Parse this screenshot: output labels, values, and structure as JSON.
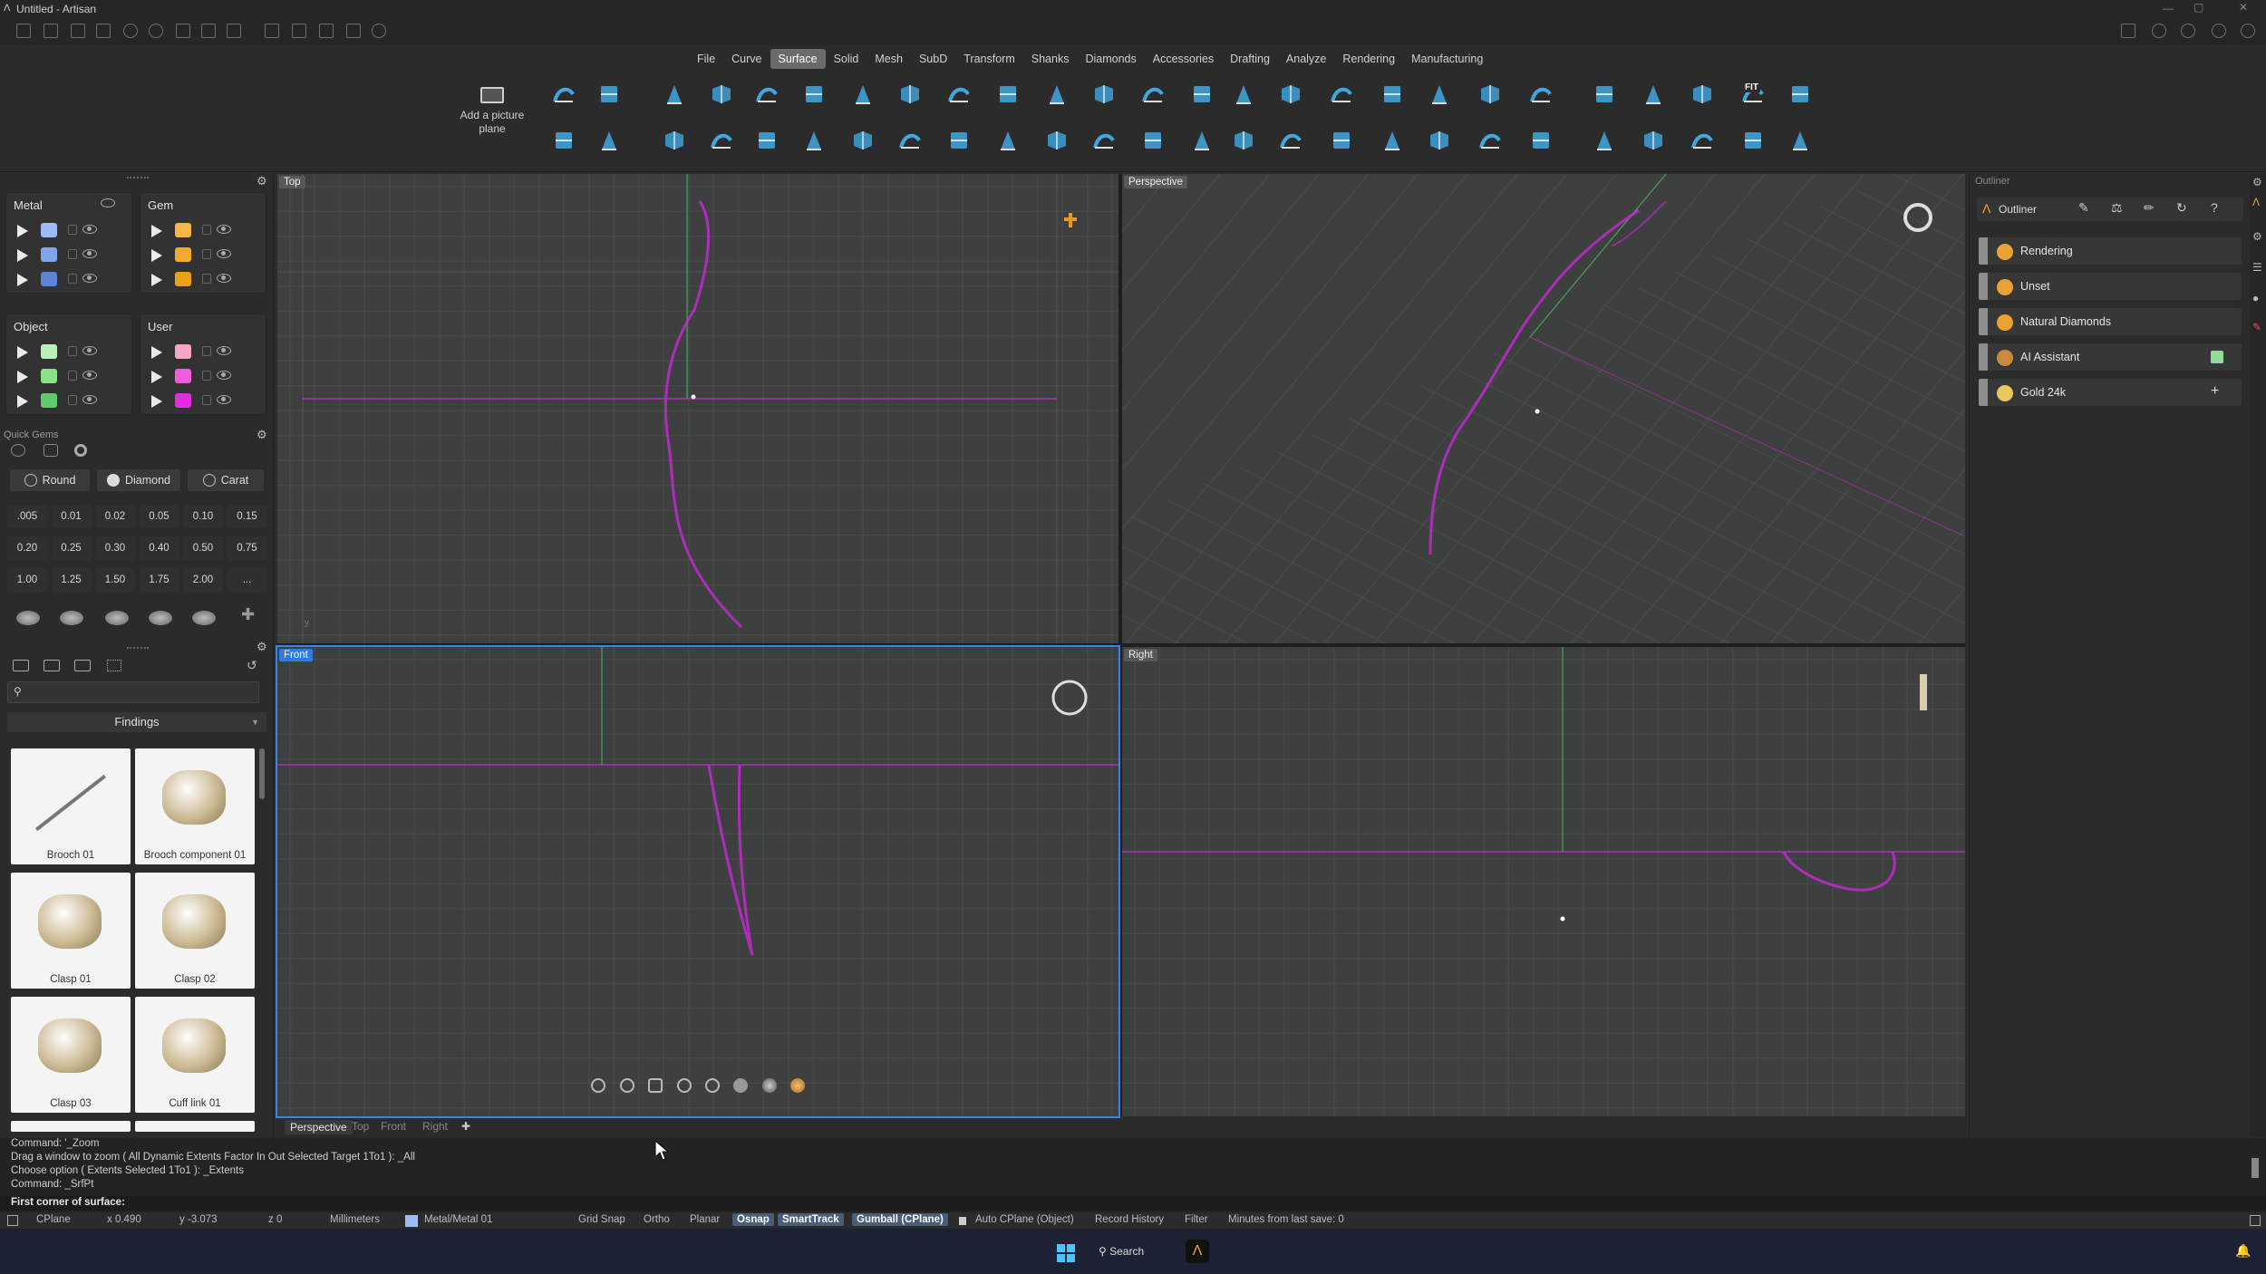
{
  "window": {
    "title": "Untitled - Artisan"
  },
  "ribbon": {
    "menu": [
      "File",
      "Curve",
      "Surface",
      "Solid",
      "Mesh",
      "SubD",
      "Transform",
      "Shanks",
      "Diamonds",
      "Accessories",
      "Drafting",
      "Analyze",
      "Rendering",
      "Manufacturing"
    ],
    "active_menu": "Surface",
    "picture_plane_label": "Add a picture plane",
    "fit_label": "FIT",
    "accent": "#3fa8e0"
  },
  "layers": {
    "metal": {
      "title": "Metal",
      "swatches": [
        "#9bbcf4",
        "#7fa5ea",
        "#5a84d6"
      ]
    },
    "gem": {
      "title": "Gem",
      "swatches": [
        "#f5b649",
        "#f1a92f",
        "#eba018"
      ]
    },
    "object": {
      "title": "Object",
      "swatches": [
        "#baf2b6",
        "#88e389",
        "#5fcb6c"
      ]
    },
    "user": {
      "title": "User",
      "swatches": [
        "#f5a7c9",
        "#ef5ddc",
        "#e52ae2"
      ]
    }
  },
  "quick_gems": {
    "title": "Quick Gems",
    "buttons": [
      "Round",
      "Diamond",
      "Carat"
    ],
    "sizes": [
      ".005",
      "0.01",
      "0.02",
      "0.05",
      "0.10",
      "0.15",
      "0.20",
      "0.25",
      "0.30",
      "0.40",
      "0.50",
      "0.75",
      "1.00",
      "1.25",
      "1.50",
      "1.75",
      "2.00",
      "..."
    ]
  },
  "library": {
    "category": "Findings",
    "search_placeholder": "",
    "items": [
      "Brooch 01",
      "Brooch component 01",
      "Clasp 01",
      "Clasp 02",
      "Clasp 03",
      "Cuff link 01"
    ]
  },
  "viewports": {
    "top": "Top",
    "perspective": "Perspective",
    "front": "Front",
    "right": "Right",
    "tabs": [
      "Perspective",
      "Top",
      "Front",
      "Right"
    ],
    "active": "Front",
    "curve_color": "#c02ad0"
  },
  "outliner": {
    "panel_title": "Outliner",
    "tab_label": "Outliner",
    "items": [
      {
        "label": "Rendering",
        "icon": "palette-icon",
        "color": "#e9a233"
      },
      {
        "label": "Unset",
        "icon": "feather-icon",
        "color": "#e9a233"
      },
      {
        "label": "Natural Diamonds",
        "icon": "diamond-icon",
        "color": "#e9a233"
      },
      {
        "label": "AI Assistant",
        "icon": "robot-icon",
        "color": "#c98a40"
      },
      {
        "label": "Gold 24k",
        "icon": "gold-sphere-icon",
        "color": "#e9c75c"
      }
    ]
  },
  "command": {
    "lines": [
      "Command: '_Zoom",
      "Drag a window to zoom ( All  Dynamic  Extents  Factor  In  Out  Selected  Target  1To1 ): _All",
      "Choose option ( Extents  Selected  1To1 ): _Extents",
      "Command: _SrfPt"
    ],
    "prompt": "First corner of surface:"
  },
  "status": {
    "cplane": "CPlane",
    "x": "x 0.490",
    "y": "y -3.073",
    "z": "z 0",
    "units": "Millimeters",
    "layer": "Metal/Metal 01",
    "grid_snap": "Grid Snap",
    "ortho": "Ortho",
    "planar": "Planar",
    "osnap": "Osnap",
    "smarttrack": "SmartTrack",
    "gumball": "Gumball (CPlane)",
    "auto_cplane": "Auto CPlane (Object)",
    "record_history": "Record History",
    "filter": "Filter",
    "minutes": "Minutes from last save: 0"
  },
  "taskbar": {
    "search": "Search"
  }
}
